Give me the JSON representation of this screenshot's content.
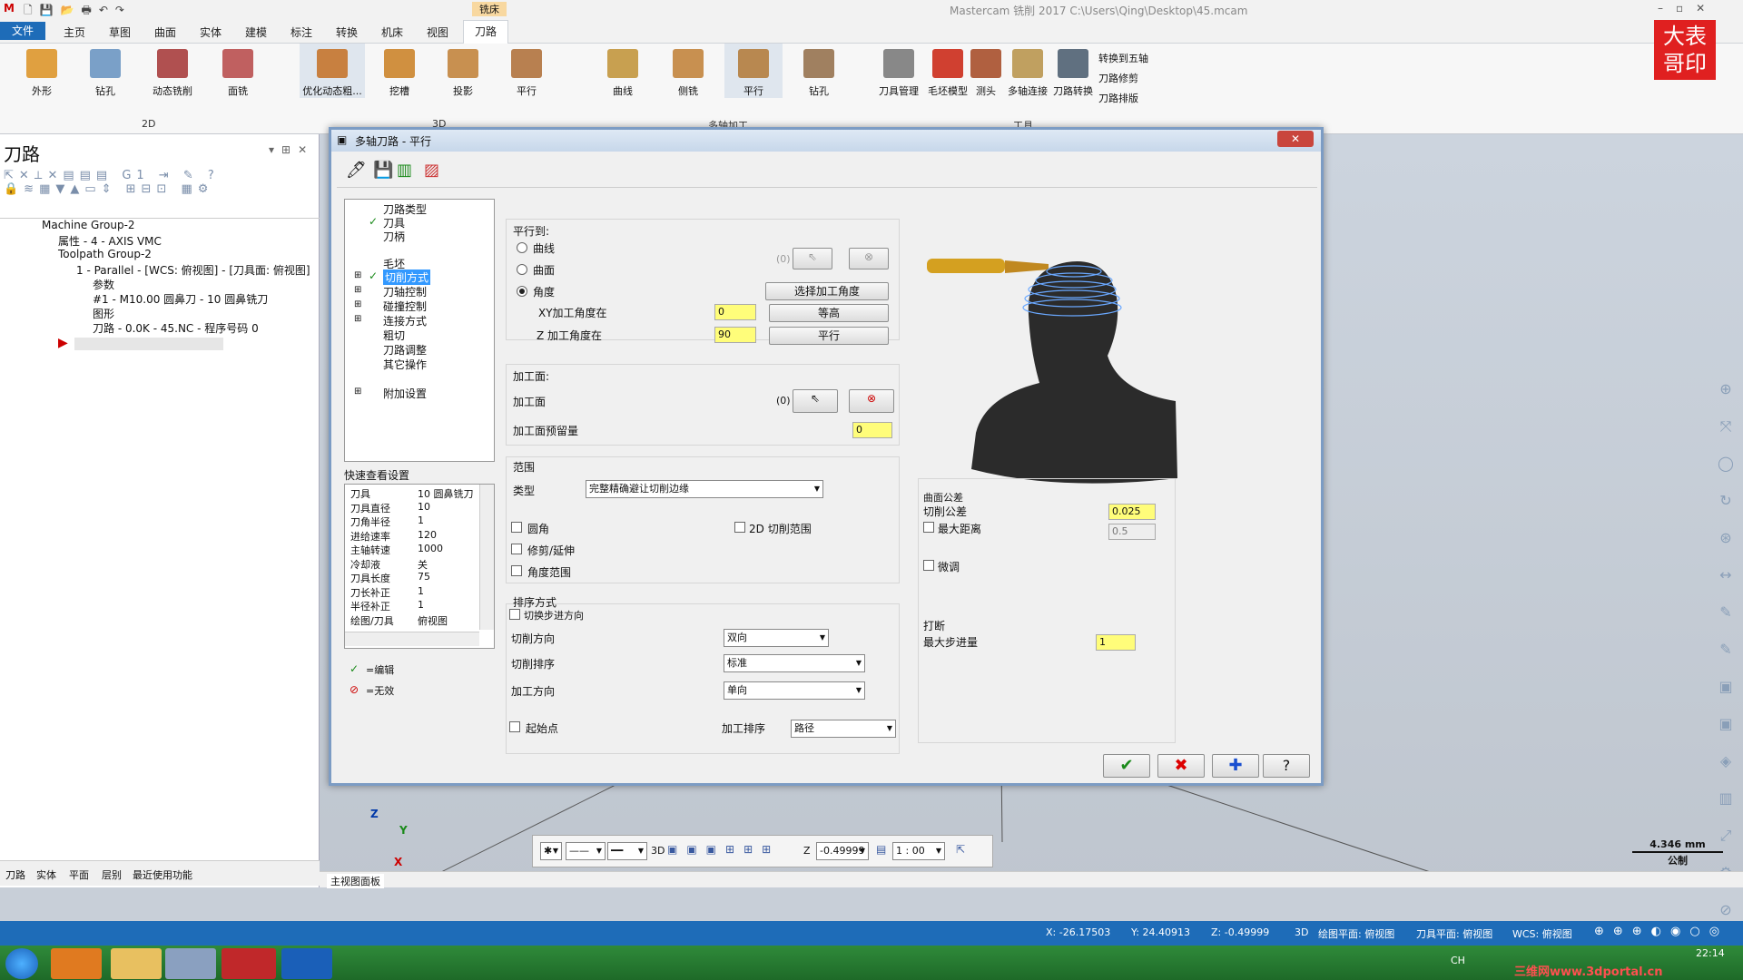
{
  "app": {
    "title": "Mastercam 铣削 2017  C:\\Users\\Qing\\Desktop\\45.mcam",
    "context_tab": "铣床"
  },
  "menu": [
    "文件",
    "主页",
    "草图",
    "曲面",
    "实体",
    "建模",
    "标注",
    "转换",
    "机床",
    "视图",
    "刀路"
  ],
  "ribbon": {
    "g2d": [
      "外形",
      "钻孔",
      "动态铣削",
      "面铣"
    ],
    "g2d_label": "2D",
    "g3d": [
      "优化动态粗...",
      "挖槽",
      "投影",
      "平行"
    ],
    "g3d_label": "3D",
    "gmulti": [
      "曲线",
      "侧铣",
      "平行",
      "钻孔"
    ],
    "gmulti_label": "多轴加工",
    "gtools": [
      "刀具管理",
      "毛坯模型",
      "测头",
      "多轴连接",
      "刀路转换"
    ],
    "gtools_side": [
      "转换到五轴",
      "刀路修剪",
      "刀路排版"
    ],
    "gtools_label": "工具"
  },
  "logo": "大表哥印",
  "left": {
    "title": "刀路",
    "tree": [
      "Machine Group-2",
      "属性 - 4 - AXIS VMC",
      "Toolpath Group-2",
      "1 - Parallel - [WCS: 俯视图] - [刀具面: 俯视图]",
      "参数",
      "#1 - M10.00 圆鼻刀 - 10 圆鼻铣刀",
      "图形",
      "刀路 - 0.0K - 45.NC - 程序号码 0"
    ],
    "tabs": [
      "刀路",
      "实体",
      "平面",
      "层别",
      "最近使用功能"
    ]
  },
  "dialog": {
    "title": "多轴刀路 - 平行",
    "nav": [
      "刀路类型",
      "刀具",
      "刀柄",
      "毛坯",
      "切削方式",
      "刀轴控制",
      "碰撞控制",
      "连接方式",
      "粗切",
      "刀路调整",
      "其它操作",
      "附加设置"
    ],
    "quick_title": "快速查看设置",
    "quick": [
      [
        "刀具",
        "10 圆鼻铣刀"
      ],
      [
        "刀具直径",
        "10"
      ],
      [
        "刀角半径",
        "1"
      ],
      [
        "进给速率",
        "120"
      ],
      [
        "主轴转速",
        "1000"
      ],
      [
        "冷却液",
        "关"
      ],
      [
        "刀具长度",
        "75"
      ],
      [
        "刀长补正",
        "1"
      ],
      [
        "半径补正",
        "1"
      ],
      [
        "绘图/刀具",
        "俯视图"
      ]
    ],
    "legend_edit": "=编辑",
    "legend_invalid": "=无效",
    "parallel_to": "平行到:",
    "opt_curve": "曲线",
    "opt_surface": "曲面",
    "opt_angle": "角度",
    "count0": "(0)",
    "select_angle": "选择加工角度",
    "xy_angle_label": "XY加工角度在",
    "xy_angle": "0",
    "z_angle_label": "Z 加工角度在",
    "z_angle": "90",
    "btn_contour": "等高",
    "btn_parallel": "平行",
    "drive_section": "加工面:",
    "drive_label": "加工面",
    "drive_count": "(0)",
    "stock_label": "加工面预留量",
    "stock": "0",
    "range_section": "范围",
    "type_label": "类型",
    "type_value": "完整精确避让切削边缘",
    "fillet": "圆角",
    "trim": "修剪/延伸",
    "angle_range": "角度范围",
    "range2d": "2D 切削范围",
    "sort_section": "排序方式",
    "step_switch": "切换步进方向",
    "cut_dir_label": "切削方向",
    "cut_dir": "双向",
    "cut_order_label": "切削排序",
    "cut_order": "标准",
    "mach_dir_label": "加工方向",
    "mach_dir": "单向",
    "start_point": "起始点",
    "mach_sort_label": "加工排序",
    "mach_sort": "路径",
    "tol_section": "曲面公差",
    "cut_tol_label": "切削公差",
    "cut_tol": "0.025",
    "max_dist_label": "最大距离",
    "max_dist": "0.5",
    "micro": "微调",
    "break_section": "打断",
    "max_step_label": "最大步进量",
    "max_step": "1"
  },
  "viewport": {
    "axis_z": "Z",
    "axis_y": "Y",
    "axis_x": "X",
    "scale": "4.346 mm",
    "unit": "公制",
    "z_label": "Z",
    "z_value": "-0.49999",
    "ratio": "1 : 00",
    "label_3d": "3D",
    "panel_tab": "主视图面板"
  },
  "status": {
    "x": "X:  -26.17503",
    "y": "Y:  24.40913",
    "z": "Z:  -0.49999",
    "d3": "3D",
    "gplane": "绘图平面: 俯视图",
    "tplane": "刀具平面: 俯视图",
    "wcs": "WCS: 俯视图"
  },
  "taskbar": {
    "time": "22:14",
    "lang": "CH",
    "watermark": "三维网www.3dportal.cn"
  },
  "colors": {
    "accent": "#1e6cb8",
    "highlight": "#fffd7a",
    "logo": "#e02020"
  }
}
